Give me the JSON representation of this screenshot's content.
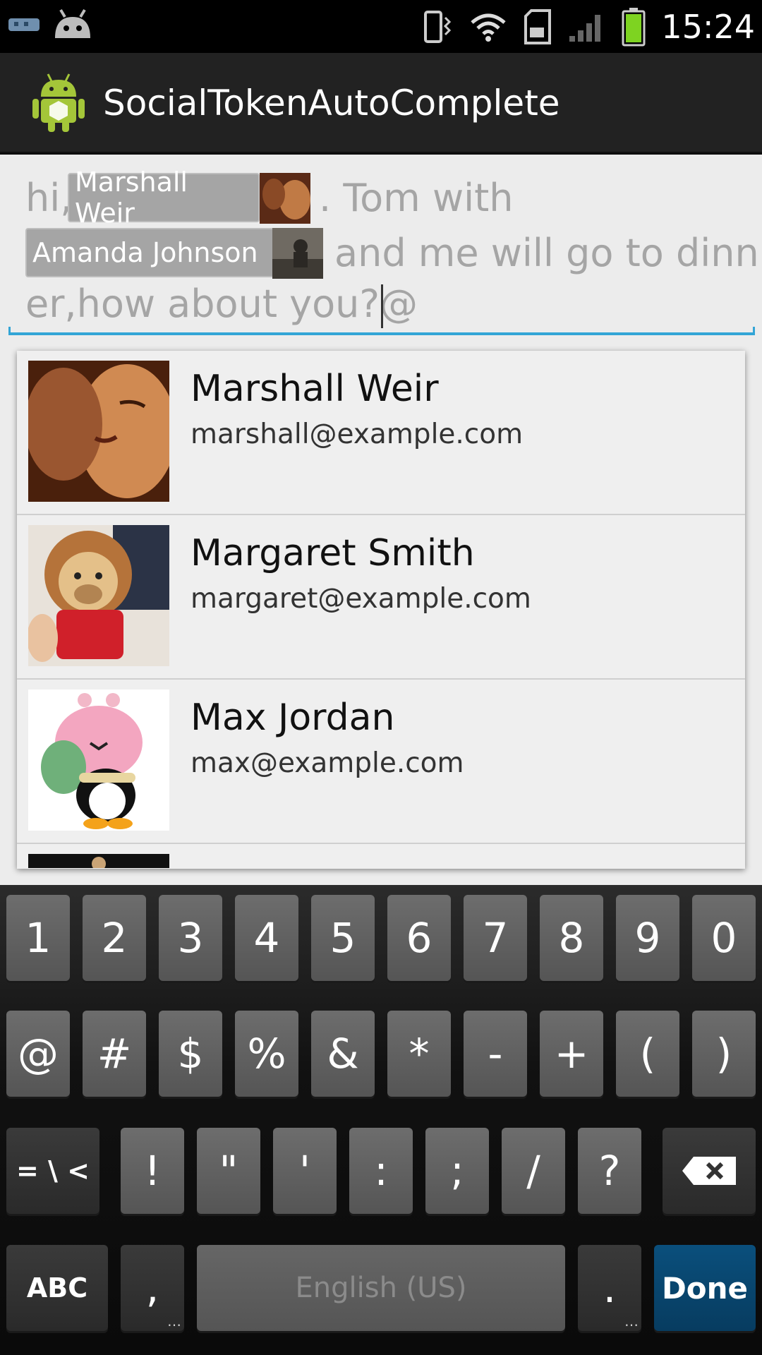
{
  "status_bar": {
    "time": "15:24",
    "left_icons": [
      "usb-icon",
      "android-notification-icon"
    ],
    "right_icons": [
      "vibrate-icon",
      "wifi-icon",
      "sd-card-icon",
      "signal-icon",
      "battery-icon"
    ]
  },
  "app": {
    "title": "SocialTokenAutoComplete",
    "icon": "android-robot-icon"
  },
  "editor": {
    "text_1": "hi,",
    "chip_1": "Marshall Weir",
    "text_2": ". Tom with",
    "chip_2": "Amanda Johnson",
    "text_3": "and me will go to dinn",
    "text_4": "er,how about you?@",
    "text_color": "#a5a5a5",
    "underline_color": "#33a5d6"
  },
  "suggestions": [
    {
      "name": "Marshall Weir",
      "email": "marshall@example.com"
    },
    {
      "name": "Margaret Smith",
      "email": "margaret@example.com"
    },
    {
      "name": "Max Jordan",
      "email": "max@example.com"
    }
  ],
  "keyboard": {
    "row1": [
      "1",
      "2",
      "3",
      "4",
      "5",
      "6",
      "7",
      "8",
      "9",
      "0"
    ],
    "row2": [
      "@",
      "#",
      "$",
      "%",
      "&",
      "*",
      "-",
      "+",
      "(",
      ")"
    ],
    "row3": {
      "shift_label": "= \\ <",
      "keys": [
        "!",
        "\"",
        "'",
        ":",
        ";",
        "/",
        "?"
      ],
      "delete_icon": "backspace-icon"
    },
    "row4": {
      "abc": "ABC",
      "comma": ",",
      "space": "English (US)",
      "period": ".",
      "done": "Done"
    },
    "done_color": "#073c60"
  }
}
